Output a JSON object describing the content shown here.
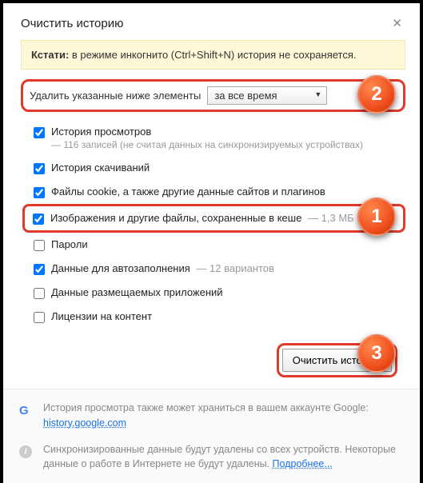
{
  "title": "Очистить историю",
  "close_tooltip": "Закрыть",
  "info_prefix": "Кстати: ",
  "info_text": "в режиме инкогнито (Ctrl+Shift+N) история не сохраняется.",
  "range": {
    "label": "Удалить указанные ниже элементы",
    "selected": "за все время"
  },
  "opts": {
    "browsing": {
      "label": "История просмотров",
      "hint": "— 116 записей (не считая данных на синхронизируемых устройствах)",
      "checked": true
    },
    "downloads": {
      "label": "История скачиваний",
      "checked": true
    },
    "cookies": {
      "label": "Файлы cookie, а также другие данные сайтов и плагинов",
      "checked": true
    },
    "cache": {
      "label": "Изображения и другие файлы, сохраненные в кеше",
      "hint": "— 1,3 МБ",
      "checked": true
    },
    "passwords": {
      "label": "Пароли",
      "checked": false
    },
    "autofill": {
      "label": "Данные для автозаполнения",
      "hint": "— 12 вариантов",
      "checked": true
    },
    "hosted": {
      "label": "Данные размещаемых приложений",
      "checked": false
    },
    "licenses": {
      "label": "Лицензии на контент",
      "checked": false
    }
  },
  "action_button": "Очистить историю",
  "footer": {
    "google_text": "История просмотра также может храниться в вашем аккаунте Google: ",
    "google_link": "history.google.com",
    "sync_text": "Синхронизированные данные будут удалены со всех устройств. Некоторые данные о работе в Интернете не будут удалены. ",
    "more_link": "Подробнее..."
  },
  "badges": {
    "b1": "1",
    "b2": "2",
    "b3": "3"
  }
}
